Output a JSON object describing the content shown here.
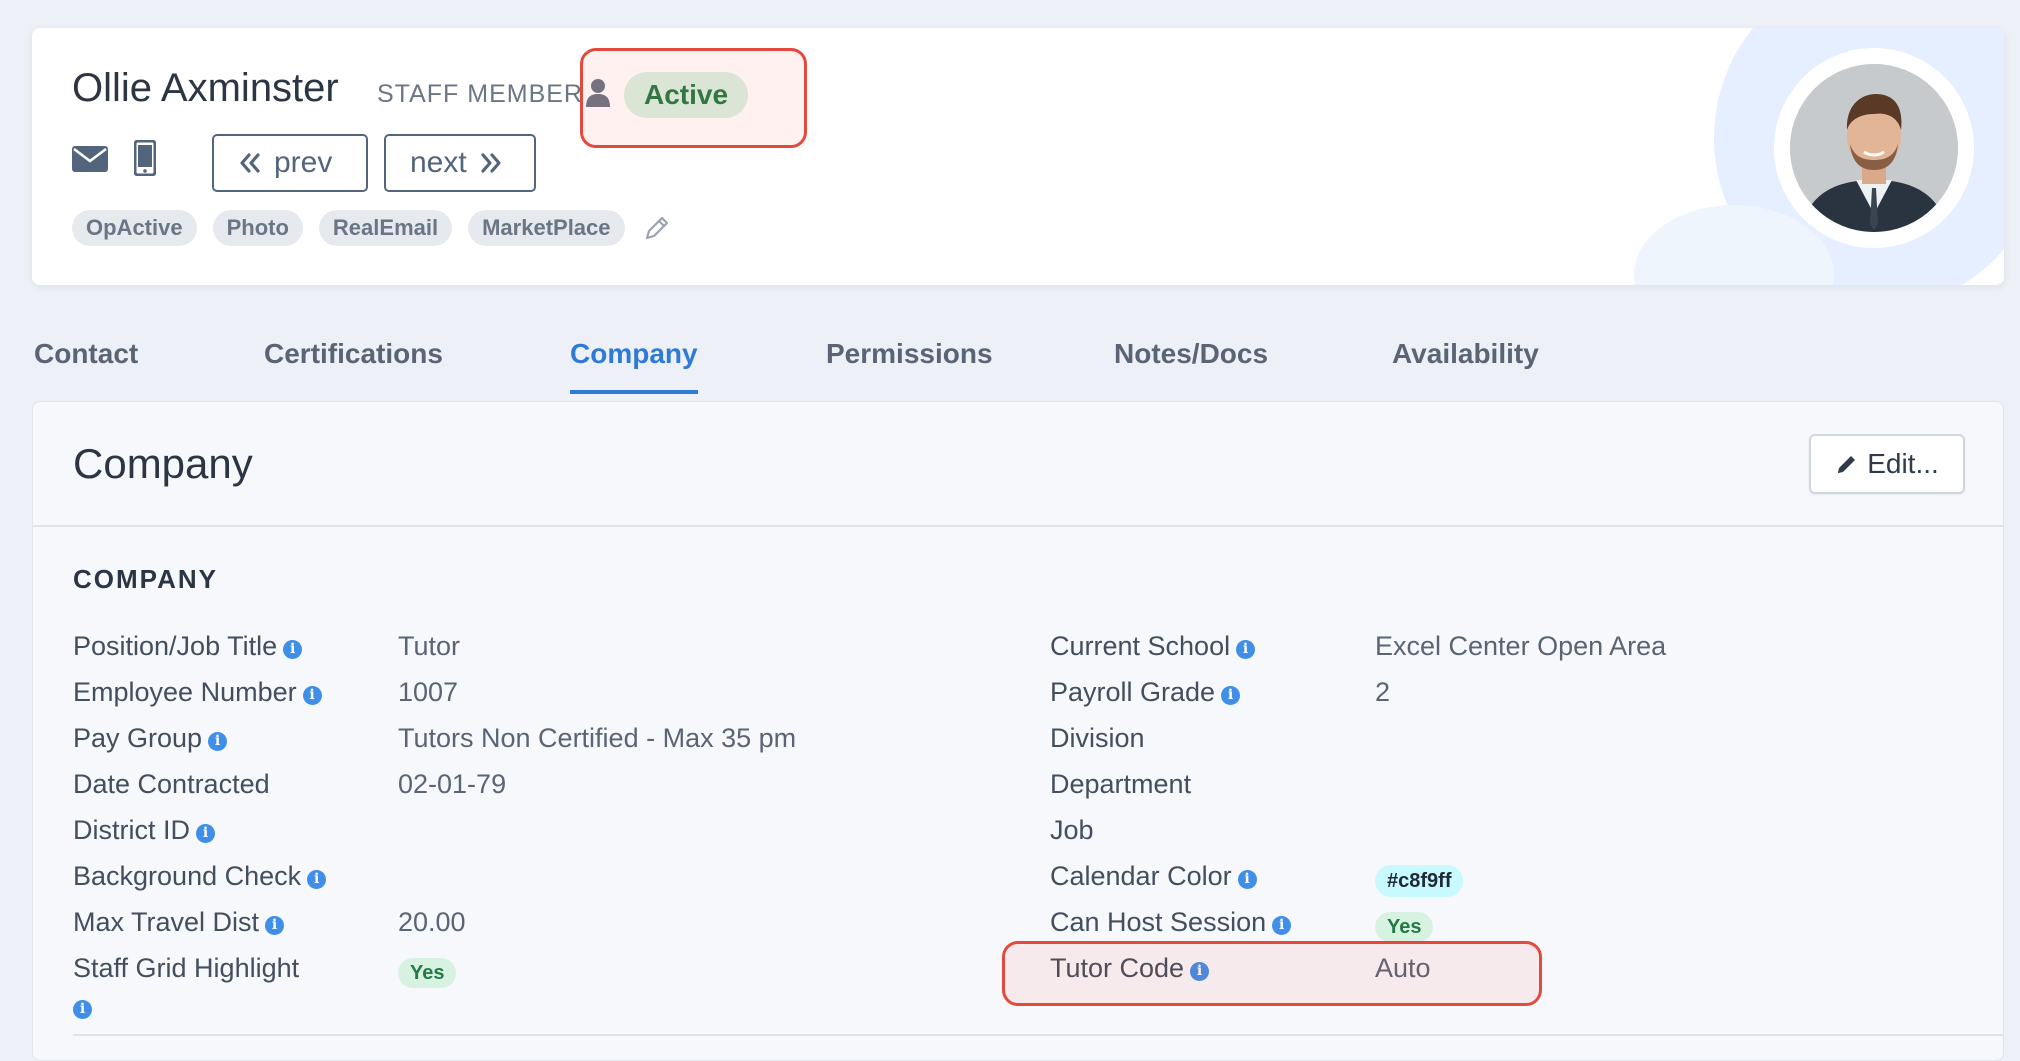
{
  "header": {
    "name": "Ollie Axminster",
    "role": "STAFF MEMBER",
    "status": "Active",
    "prev_label": "prev",
    "next_label": "next",
    "tags": [
      "OpActive",
      "Photo",
      "RealEmail",
      "MarketPlace"
    ]
  },
  "tabs": [
    {
      "label": "Contact",
      "active": false
    },
    {
      "label": "Certifications",
      "active": false
    },
    {
      "label": "Company",
      "active": true
    },
    {
      "label": "Permissions",
      "active": false
    },
    {
      "label": "Notes/Docs",
      "active": false
    },
    {
      "label": "Availability",
      "active": false
    }
  ],
  "panel": {
    "title": "Company",
    "edit_label": "Edit...",
    "section_heading": "COMPANY"
  },
  "fields_left": [
    {
      "label": "Position/Job Title",
      "value": "Tutor",
      "info": true
    },
    {
      "label": "Employee Number",
      "value": "1007",
      "info": true
    },
    {
      "label": "Pay Group",
      "value": "Tutors Non Certified - Max 35 pm",
      "info": true
    },
    {
      "label": "Date Contracted",
      "value": "02-01-79",
      "info": false
    },
    {
      "label": "District ID",
      "value": "",
      "info": true
    },
    {
      "label": "Background Check",
      "value": "",
      "info": true
    },
    {
      "label": "Max Travel Dist",
      "value": "20.00",
      "info": true
    },
    {
      "label": "Staff Grid Highlight",
      "value": "Yes",
      "info": true
    }
  ],
  "fields_right": [
    {
      "label": "Current School",
      "value": "Excel Center Open Area",
      "info": true
    },
    {
      "label": "Payroll Grade",
      "value": "2",
      "info": true
    },
    {
      "label": "Division",
      "value": "",
      "info": false
    },
    {
      "label": "Department",
      "value": "",
      "info": false
    },
    {
      "label": "Job",
      "value": "",
      "info": false
    },
    {
      "label": "Calendar Color",
      "value": "#c8f9ff",
      "info": true
    },
    {
      "label": "Can Host Session",
      "value": "Yes",
      "info": true
    },
    {
      "label": "Tutor Code",
      "value": "Auto",
      "info": true
    }
  ],
  "colors": {
    "accent": "#2f7ad9",
    "status_green_bg": "#d8f2e2",
    "status_green_text": "#237a45",
    "highlight_red": "#e34a3d",
    "calendar_color": "#c8f9ff"
  },
  "icons": [
    "person-icon",
    "mail-icon",
    "mobile-phone-icon",
    "double-chevron-left-icon",
    "double-chevron-right-icon",
    "pencil-icon",
    "info-icon"
  ]
}
